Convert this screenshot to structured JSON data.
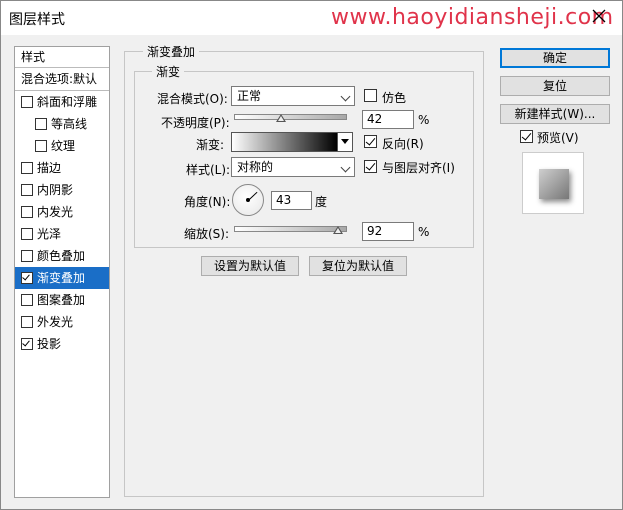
{
  "window": {
    "title": "图层样式",
    "watermark": "www.haoyidiansheji.com"
  },
  "left_panel": {
    "header": "样式",
    "blend_options": "混合选项:默认",
    "items": [
      {
        "label": "斜面和浮雕",
        "checked": false,
        "sub": false
      },
      {
        "label": "等高线",
        "checked": false,
        "sub": true
      },
      {
        "label": "纹理",
        "checked": false,
        "sub": true
      },
      {
        "label": "描边",
        "checked": false,
        "sub": false
      },
      {
        "label": "内阴影",
        "checked": false,
        "sub": false
      },
      {
        "label": "内发光",
        "checked": false,
        "sub": false
      },
      {
        "label": "光泽",
        "checked": false,
        "sub": false
      },
      {
        "label": "颜色叠加",
        "checked": false,
        "sub": false
      },
      {
        "label": "渐变叠加",
        "checked": true,
        "sub": false,
        "selected": true
      },
      {
        "label": "图案叠加",
        "checked": false,
        "sub": false
      },
      {
        "label": "外发光",
        "checked": false,
        "sub": false
      },
      {
        "label": "投影",
        "checked": true,
        "sub": false
      }
    ]
  },
  "gradient_overlay": {
    "group_title": "渐变叠加",
    "sub_group_title": "渐变",
    "blend_mode_label": "混合模式(O):",
    "blend_mode_value": "正常",
    "dither_label": "仿色",
    "dither_checked": false,
    "opacity_label": "不透明度(P):",
    "opacity_value": "42",
    "opacity_percent": 42,
    "percent_sign": "%",
    "gradient_label": "渐变:",
    "reverse_label": "反向(R)",
    "reverse_checked": true,
    "style_label": "样式(L):",
    "style_value": "对称的",
    "align_label": "与图层对齐(I)",
    "align_checked": true,
    "angle_label": "角度(N):",
    "angle_value": "43",
    "angle_unit": "度",
    "scale_label": "缩放(S):",
    "scale_value": "92",
    "scale_percent": 92,
    "scale_percent_sign": "%",
    "set_default_label": "设置为默认值",
    "reset_default_label": "复位为默认值"
  },
  "right_buttons": {
    "ok": "确定",
    "reset": "复位",
    "new_style": "新建样式(W)...",
    "preview_label": "预览(V)",
    "preview_checked": true
  }
}
